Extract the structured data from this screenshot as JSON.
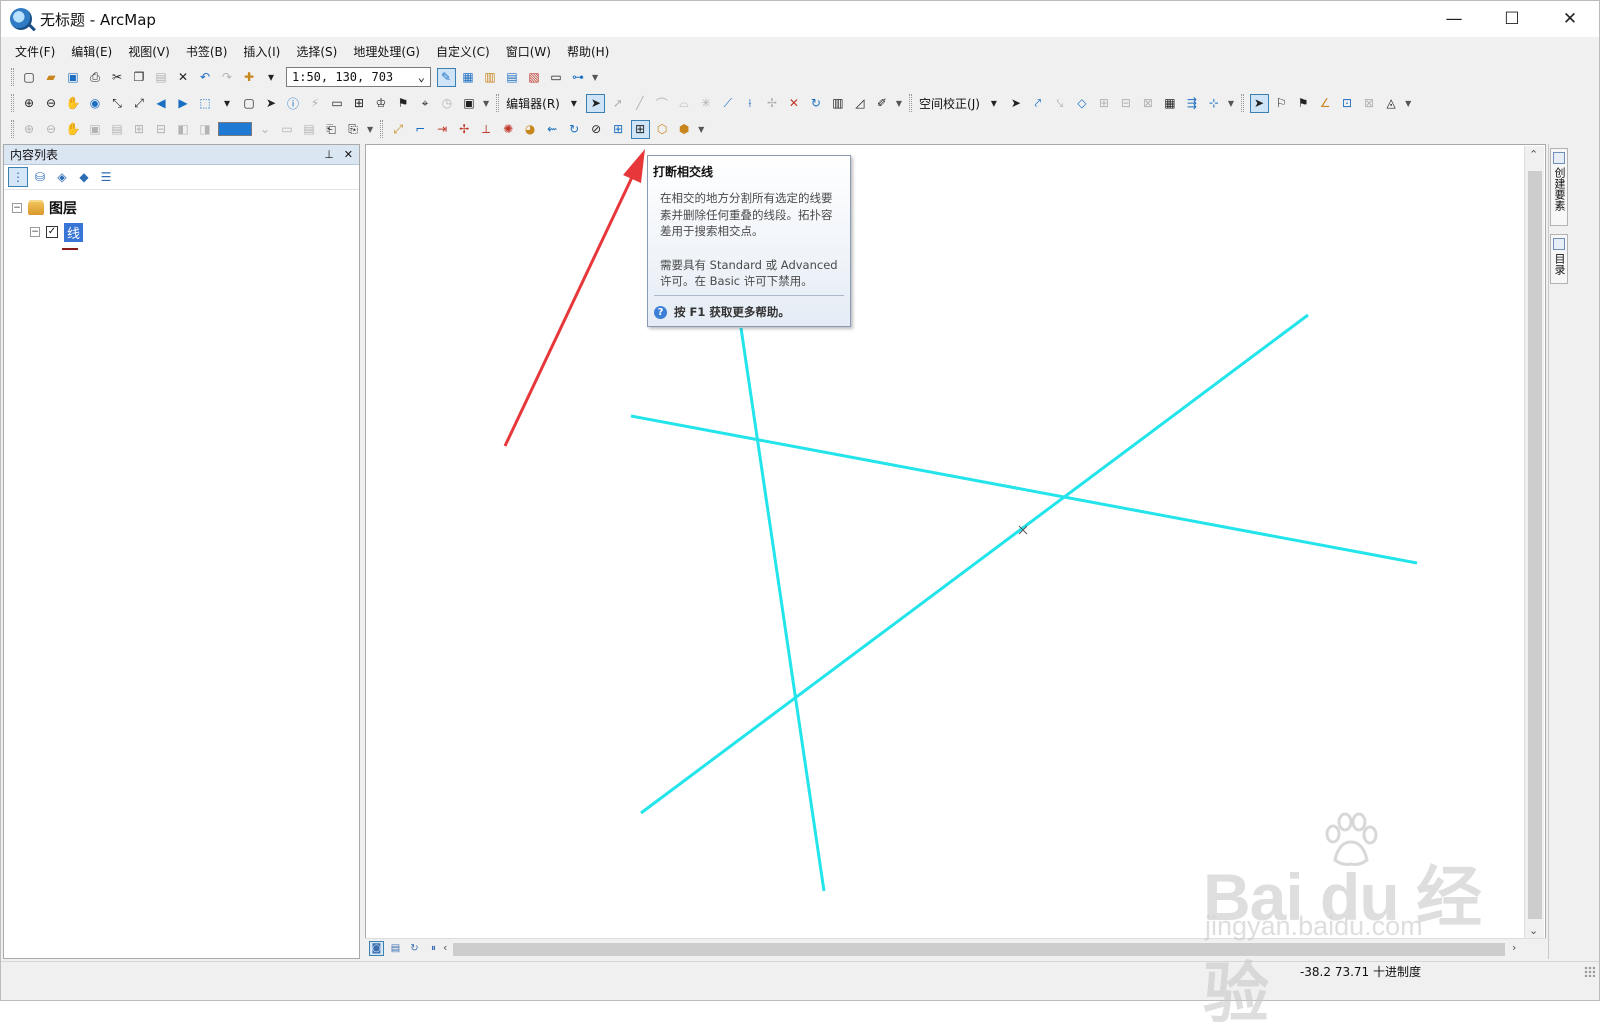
{
  "window": {
    "title": "无标题 - ArcMap",
    "controls": [
      "—",
      "☐",
      "✕"
    ]
  },
  "menu": [
    "文件(F)",
    "编辑(E)",
    "视图(V)",
    "书签(B)",
    "插入(I)",
    "选择(S)",
    "地理处理(G)",
    "自定义(C)",
    "窗口(W)",
    "帮助(H)"
  ],
  "toolbar": {
    "scale_value": "1:50, 130, 703",
    "editor_label": "编辑器(R)",
    "spatial_adjust_label": "空间校正(J)"
  },
  "toc": {
    "title": "内容列表",
    "group_label": "图层",
    "layer_label": "线"
  },
  "tooltip": {
    "title": "打断相交线",
    "lines": [
      "在相交的地方分割所有选定的线要",
      "素并删除任何重叠的线段。拓扑容",
      "差用于搜索相交点。"
    ],
    "license_lines": [
      "需要具有 Standard 或 Advanced",
      "许可。在 Basic 许可下禁用。"
    ],
    "help_text": "按 F1 获取更多帮助。"
  },
  "dock_tabs": [
    "创建要素",
    "目录"
  ],
  "status": {
    "coords": "-38.2  73.71 十进制度"
  },
  "watermark": {
    "brand": "Bai du 经验",
    "url": "jingyan.baidu.com"
  },
  "colors": {
    "line_feature": "#22e4ea",
    "arrow": "#e8373a",
    "accent": "#3875d7"
  }
}
